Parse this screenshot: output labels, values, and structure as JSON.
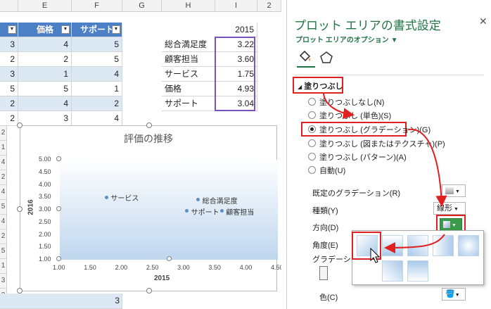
{
  "sheet": {
    "columns": [
      "E",
      "F",
      "G",
      "H",
      "I",
      "2"
    ],
    "table_headers": {
      "price": "価格",
      "support": "サポート"
    },
    "rows": [
      [
        "3",
        "4",
        "5"
      ],
      [
        "2",
        "2",
        "5"
      ],
      [
        "3",
        "1",
        "4"
      ],
      [
        "5",
        "5",
        "1"
      ],
      [
        "2",
        "4",
        "2"
      ],
      [
        "2",
        "3",
        "4"
      ]
    ],
    "summary_col_header": "2015",
    "summary": [
      {
        "label": "総合満足度",
        "value": "3.22"
      },
      {
        "label": "顧客担当",
        "value": "3.60"
      },
      {
        "label": "サービス",
        "value": "1.75"
      },
      {
        "label": "価格",
        "value": "4.93"
      },
      {
        "label": "サポート",
        "value": "3.04"
      }
    ],
    "side_rows": [
      "2",
      "1",
      "4",
      "2",
      "4",
      "5",
      "4",
      "2",
      "5",
      "1",
      "3",
      "3",
      "5"
    ],
    "bottom_cell": "3"
  },
  "chart_data": {
    "type": "scatter",
    "title": "評価の推移",
    "xlabel": "2015",
    "ylabel": "2016",
    "xlim": [
      1.0,
      4.5
    ],
    "ylim": [
      1.0,
      5.0
    ],
    "x_ticks": [
      "1.00",
      "1.50",
      "2.00",
      "2.50",
      "3.00",
      "3.50",
      "4.00",
      "4.50"
    ],
    "y_ticks": [
      "5.00",
      "4.50",
      "4.00",
      "3.50",
      "3.00",
      "2.50",
      "2.00",
      "1.50",
      "1.00"
    ],
    "points": [
      {
        "name": "サービス",
        "x": 1.75,
        "y": 3.5
      },
      {
        "name": "総合満足度",
        "x": 3.22,
        "y": 3.4
      },
      {
        "name": "サポート",
        "x": 3.04,
        "y": 2.95
      },
      {
        "name": "顧客担当",
        "x": 3.6,
        "y": 2.95
      }
    ]
  },
  "pane": {
    "title": "プロット エリアの書式設定",
    "subtitle": "プロット エリアのオプション",
    "close": "✕",
    "section": "塗りつぶし",
    "options": [
      "塗りつぶしなし(N)",
      "塗りつぶし (単色)(S)",
      "塗りつぶし (グラデーション)(G)",
      "塗りつぶし (図またはテクスチャ)(P)",
      "塗りつぶし (パターン)(A)",
      "自動(U)"
    ],
    "preset_label": "既定のグラデーション(R)",
    "type_label": "種類(Y)",
    "type_value": "線形",
    "direction_label": "方向(D)",
    "angle_label": "角度(E)",
    "gradient_label": "グラデーション",
    "color_label": "色(C)"
  }
}
